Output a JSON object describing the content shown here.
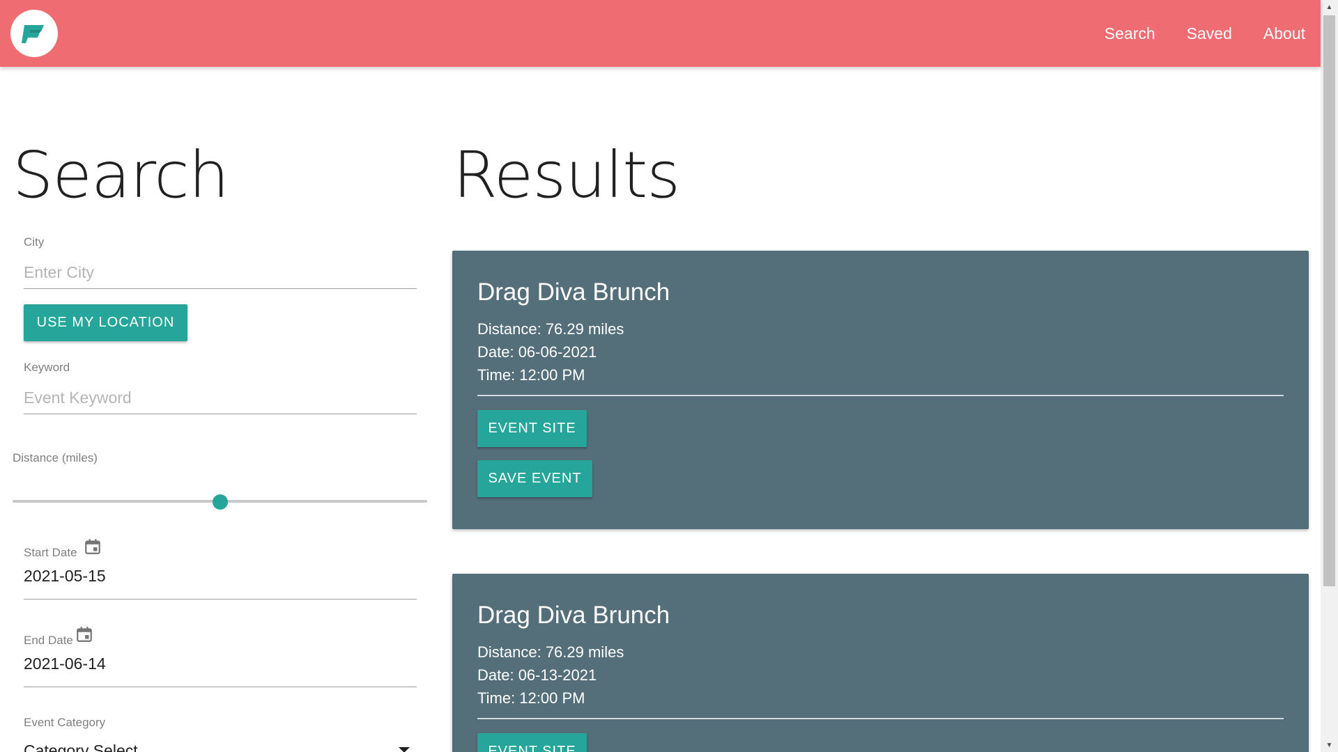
{
  "nav": {
    "logo_letter": "F",
    "links": [
      "Search",
      "Saved",
      "About"
    ]
  },
  "search": {
    "title": "Search",
    "city_label": "City",
    "city_placeholder": "Enter City",
    "use_location_label": "USE MY LOCATION",
    "keyword_label": "Keyword",
    "keyword_placeholder": "Event Keyword",
    "distance_label": "Distance (miles)",
    "distance_slider_fraction": 0.5,
    "start_date_label": "Start Date",
    "start_date_value": "2021-05-15",
    "end_date_label": "End Date",
    "end_date_value": "2021-06-14",
    "category_label": "Event Category",
    "category_value": "Category Select"
  },
  "results": {
    "title": "Results",
    "cards": [
      {
        "name": "Drag Diva Brunch",
        "distance": "Distance: 76.29 miles",
        "date": "Date: 06-06-2021",
        "time": "Time: 12:00 PM",
        "event_site_label": "EVENT SITE",
        "save_label": "SAVE EVENT"
      },
      {
        "name": "Drag Diva Brunch",
        "distance": "Distance: 76.29 miles",
        "date": "Date: 06-13-2021",
        "time": "Time: 12:00 PM",
        "event_site_label": "EVENT SITE"
      }
    ]
  },
  "colors": {
    "navbar": "#ef6d72",
    "accent": "#26a69a",
    "card": "#546e7a"
  },
  "icons": {
    "logo": "brand-logo-icon",
    "calendar": "calendar-icon",
    "dropdown": "caret-down-icon"
  }
}
